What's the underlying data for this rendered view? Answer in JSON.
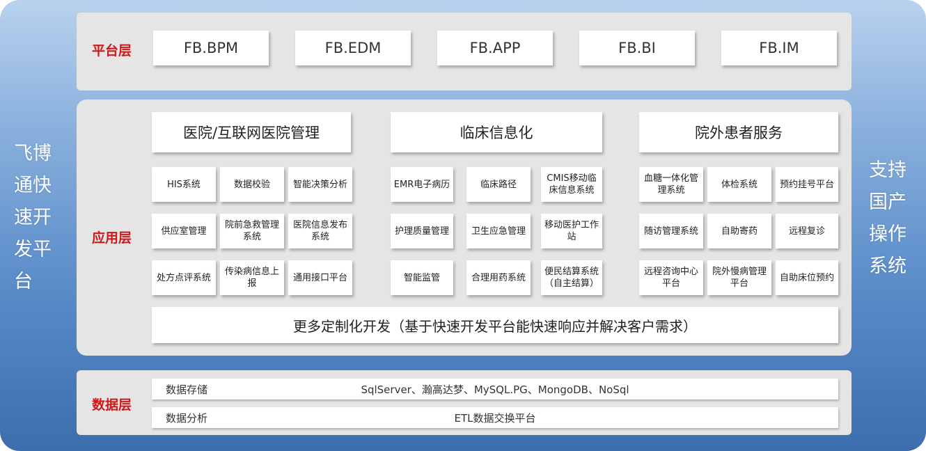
{
  "left_side": [
    "飞博",
    "通快",
    "速开",
    "发平",
    "台"
  ],
  "right_side": [
    "支持",
    "国产",
    "操作",
    "系统"
  ],
  "platform": {
    "label": "平台层",
    "items": [
      "FB.BPM",
      "FB.EDM",
      "FB.APP",
      "FB.BI",
      "FB.IM"
    ]
  },
  "application": {
    "label": "应用层",
    "sections": [
      {
        "title": "医院/互联网医院管理",
        "items": [
          "HIS系统",
          "数据校验",
          "智能决策分析",
          "供应室管理",
          "院前急救管理系统",
          "医院信息发布系统",
          "处方点评系统",
          "传染病信息上报",
          "通用接口平台"
        ]
      },
      {
        "title": "临床信息化",
        "items": [
          "EMR电子病历",
          "临床路径",
          "CMIS移动临床信息系统",
          "护理质量管理",
          "卫生应急管理",
          "移动医护工作站",
          "智能监管",
          "合理用药系统",
          "便民结算系统（自主结算）"
        ]
      },
      {
        "title": "院外患者服务",
        "items": [
          "血糖一体化管理系统",
          "体检系统",
          "预约挂号平台",
          "随访管理系统",
          "自助寄药",
          "远程复诊",
          "远程咨询中心平台",
          "院外慢病管理平台",
          "自助床位预约"
        ]
      }
    ],
    "more": "更多定制化开发（基于快速开发平台能快速响应并解决客户需求）"
  },
  "data_layer": {
    "label": "数据层",
    "rows": [
      {
        "label": "数据存储",
        "value": "SqlServer、瀚高达梦、MySQL.PG、MongoDB、NoSql"
      },
      {
        "label": "数据分析",
        "value": "ETL数据交换平台"
      }
    ]
  },
  "colors": {
    "accent_label": "#cc1a1a",
    "panel_bg": "#e5e5e5",
    "outer_gradient_top": "#b9d2ee",
    "outer_gradient_bottom": "#3c6eae"
  }
}
